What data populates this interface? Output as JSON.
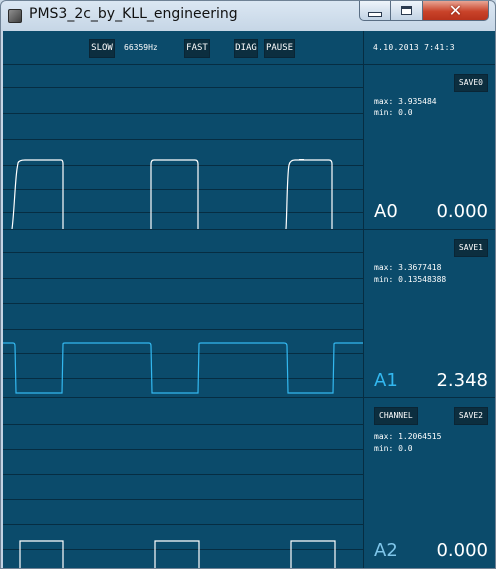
{
  "window": {
    "title": "PMS3_2c_by_KLL_engineering",
    "close_glyph": "✕"
  },
  "toolbar": {
    "slow_label": "SLOW",
    "rate": "66359Hz",
    "fast_label": "FAST",
    "diag_label": "DIAG",
    "pause_label": "PAUSE",
    "datetime": "4.10.2013 7:41:3"
  },
  "channels": [
    {
      "name": "A0",
      "value": "0.000",
      "save_label": "SAVE0",
      "max_text": "max: 3.935484",
      "min_text": "min: 0.0",
      "color": "#ffffff",
      "name_color": "#ffffff"
    },
    {
      "name": "A1",
      "value": "2.348",
      "save_label": "SAVE1",
      "max_text": "max: 3.3677418",
      "min_text": "min: 0.13548388",
      "color": "#33b8f0",
      "name_color": "#33b8f0"
    },
    {
      "name": "A2",
      "value": "0.000",
      "save_label": "SAVE2",
      "channel_label": "CHANNEL",
      "max_text": "max: 1.2064515",
      "min_text": "min: 0.0",
      "color": "#ffffff",
      "name_color": "#7fc6ea"
    }
  ],
  "colors": {
    "background": "#0b4b6b",
    "gridline": "#062d42",
    "button_bg": "#0c2e3f"
  }
}
